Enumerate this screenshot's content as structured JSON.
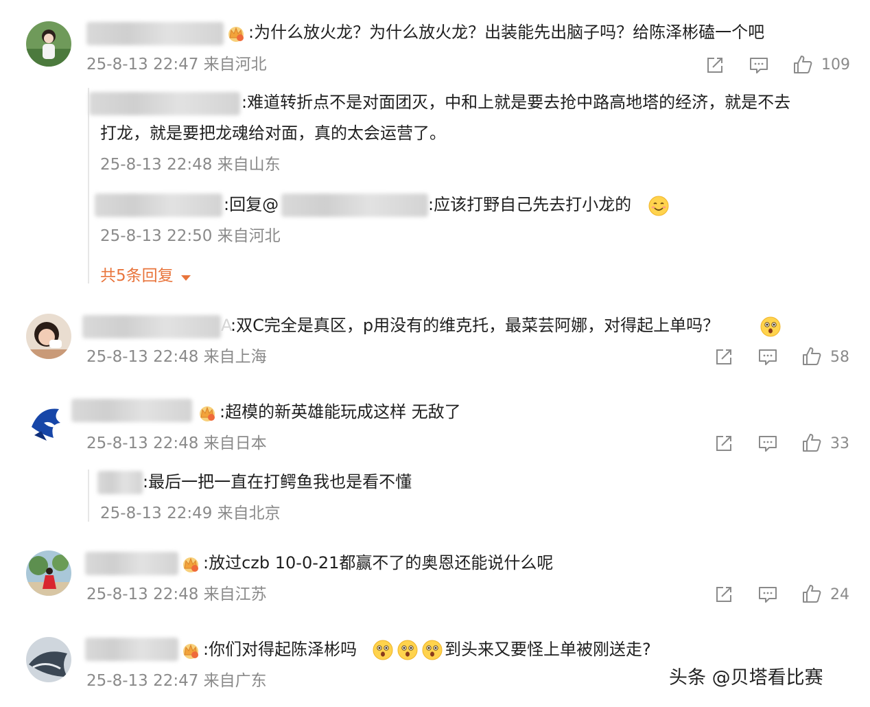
{
  "comments": [
    {
      "text": ":为什么放火龙？为什么放火龙？出装能先出脑子吗？给陈泽彬磕一个吧",
      "meta": "25-8-13 22:47 来自河北",
      "likes": "109",
      "replies": [
        {
          "text1": ":难道转折点不是对面团灭，中和上就是要去抢中路高地塔的经济，就是不去",
          "text2": "打龙，就是要把龙魂给对面，真的太会运营了。",
          "meta": "25-8-13 22:48 来自山东"
        },
        {
          "text_a": ":回复@",
          "text_b": ":应该打野自己先去打小龙的",
          "meta": "25-8-13 22:50 来自河北"
        }
      ],
      "more_replies": "共5条回复"
    },
    {
      "text": ":双C完全是真区，p用没有的维克托，最菜芸阿娜，对得起上单吗？",
      "name_tail": "A",
      "meta": "25-8-13 22:48 来自上海",
      "likes": "58"
    },
    {
      "text": ":超模的新英雄能玩成这样 无敌了",
      "meta": "25-8-13 22:48 来自日本",
      "likes": "33",
      "reply": {
        "text": ":最后一把一直在打鳄鱼我也是看不懂",
        "meta": "25-8-13 22:49 来自北京"
      }
    },
    {
      "text": ":放过czb 10-0-21都赢不了的奥恩还能说什么呢",
      "meta": "25-8-13 22:48 来自江苏",
      "likes": "24"
    },
    {
      "text_a": ":你们对得起陈泽彬吗",
      "text_b": "到头来又要怪上单被刚送走?",
      "meta": "25-8-13 22:47 来自广东"
    }
  ],
  "watermark": "头条 @贝塔看比赛",
  "colors": {
    "meta": "#8a8a8a",
    "more_replies": "#e8743b",
    "crown": "#f2a33a"
  },
  "icons": [
    "share-icon",
    "comment-icon",
    "thumbs-up-icon",
    "crown-icon",
    "smile-emoji",
    "surprised-emoji"
  ]
}
